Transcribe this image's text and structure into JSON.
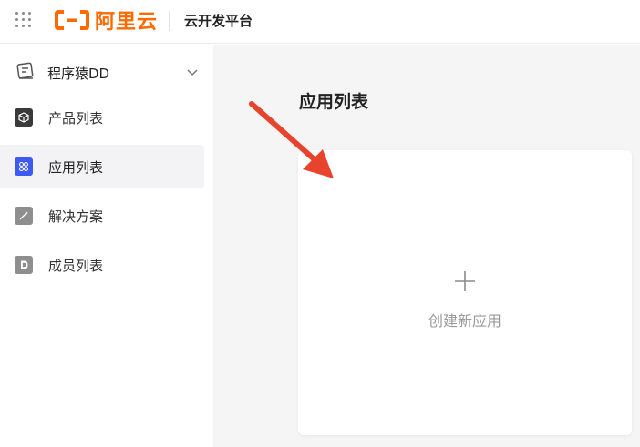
{
  "header": {
    "logo_text": "阿里云",
    "platform_title": "云开发平台"
  },
  "sidebar": {
    "org_name": "程序猿DD",
    "items": [
      {
        "label": "产品列表",
        "icon": "cube-icon",
        "active": false
      },
      {
        "label": "应用列表",
        "icon": "apps-icon",
        "active": true
      },
      {
        "label": "解决方案",
        "icon": "wand-icon",
        "active": false
      },
      {
        "label": "成员列表",
        "icon": "member-icon",
        "active": false
      }
    ]
  },
  "main": {
    "page_title": "应用列表",
    "create_card_label": "创建新应用"
  },
  "colors": {
    "brand": "#ff6a00",
    "active_icon": "#3d5af1",
    "arrow": "#e8432c"
  }
}
